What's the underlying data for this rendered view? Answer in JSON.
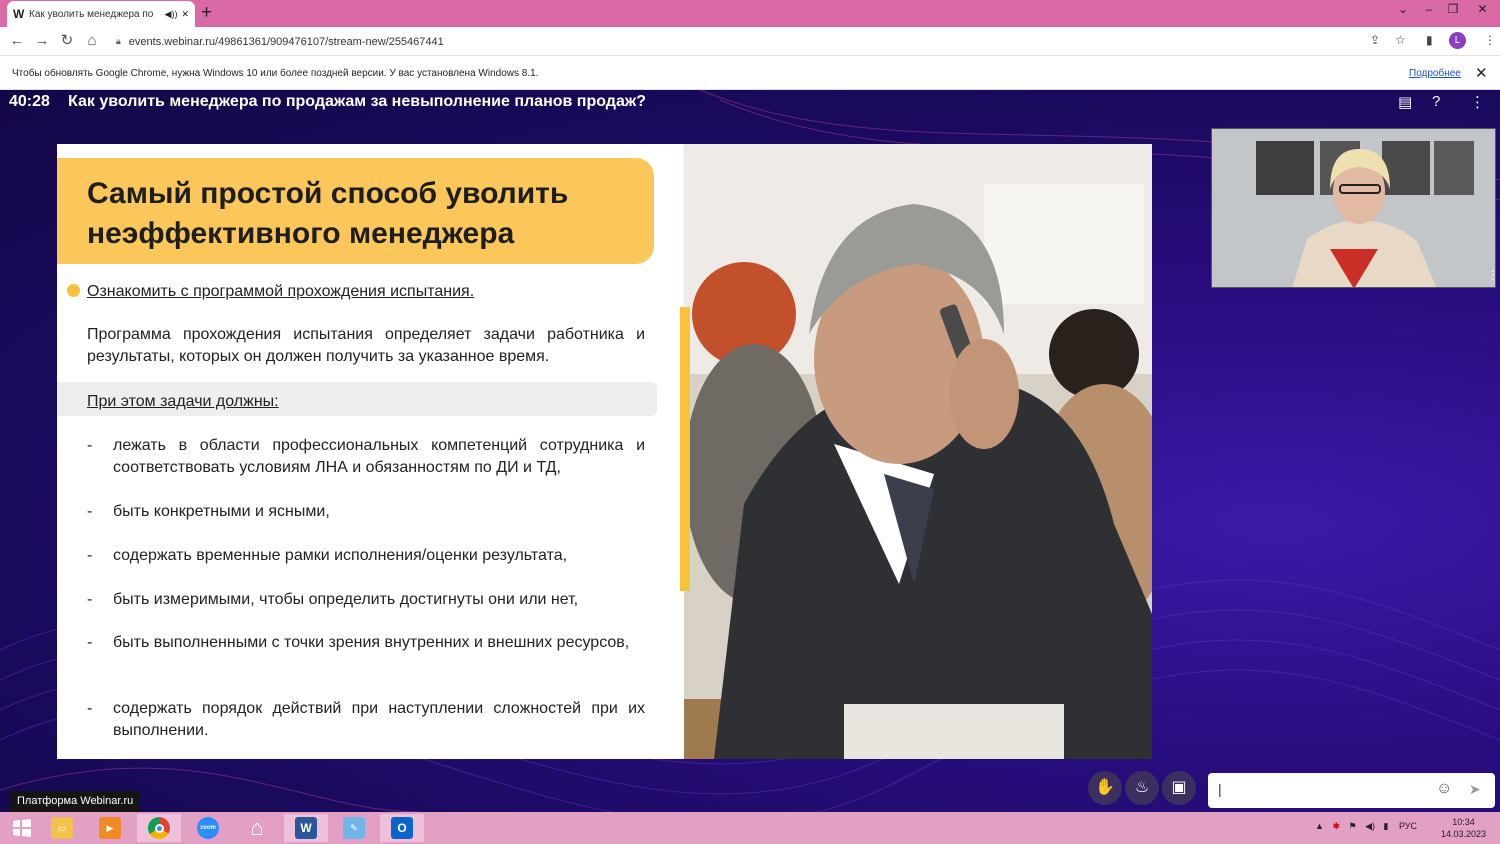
{
  "browser": {
    "tab_title": "Как уволить менеджера по",
    "tab_favicon": "W",
    "new_tab": "+",
    "url": "events.webinar.ru/49861361/909476107/stream-new/255467441",
    "profile_initial": "L",
    "win_min": "⌄",
    "win_minimize": "–",
    "win_restore": "❐",
    "win_close": "✕"
  },
  "infobar": {
    "message": "Чтобы обновлять Google Chrome, нужна Windows 10 или более поздней версии. У вас установлена Windows 8.1.",
    "link": "Подробнее",
    "close": "✕"
  },
  "webinar": {
    "timer": "40:28",
    "title": "Как уволить менеджера по продажам за невыполнение планов продаж?",
    "platform_label": "Платформа Webinar.ru",
    "chat_placeholder": "|"
  },
  "slide": {
    "heading": "Самый простой способ уволить неэффективного менеджера",
    "subheading": "Ознакомить с программой прохождения испытания.",
    "paragraph": "Программа прохождения испытания определяет задачи работника и результаты, которых он должен получить за указанное время.",
    "tasks_label": "При этом задачи должны:",
    "items": [
      "лежать в области профессиональных компетенций сотрудника и соответствовать условиям ЛНА и обязанностям по ДИ и ТД,",
      "быть конкретными и ясными,",
      "содержать временные рамки исполнения/оценки результата,",
      "быть измеримыми, чтобы определить достигнуты они или нет,",
      "быть выполненными с точки зрения внутренних и внешних ресурсов,",
      "содержать порядок действий при наступлении сложностей при их выполнении."
    ],
    "dash": "-"
  },
  "taskbar": {
    "apps": [
      "start",
      "file-explorer",
      "media-player",
      "chrome",
      "zoom",
      "home",
      "word",
      "paint",
      "outlook"
    ],
    "zoom_label": "zoom",
    "word_label": "W",
    "outlook_label": "O",
    "lang": "РУС",
    "time": "10:34",
    "date": "14.03.2023"
  },
  "colors": {
    "tabbar": "#d96aa6",
    "stage": "#1f0b6a",
    "accent_yellow": "#fbc75a",
    "taskbar": "#e2a0c5"
  }
}
